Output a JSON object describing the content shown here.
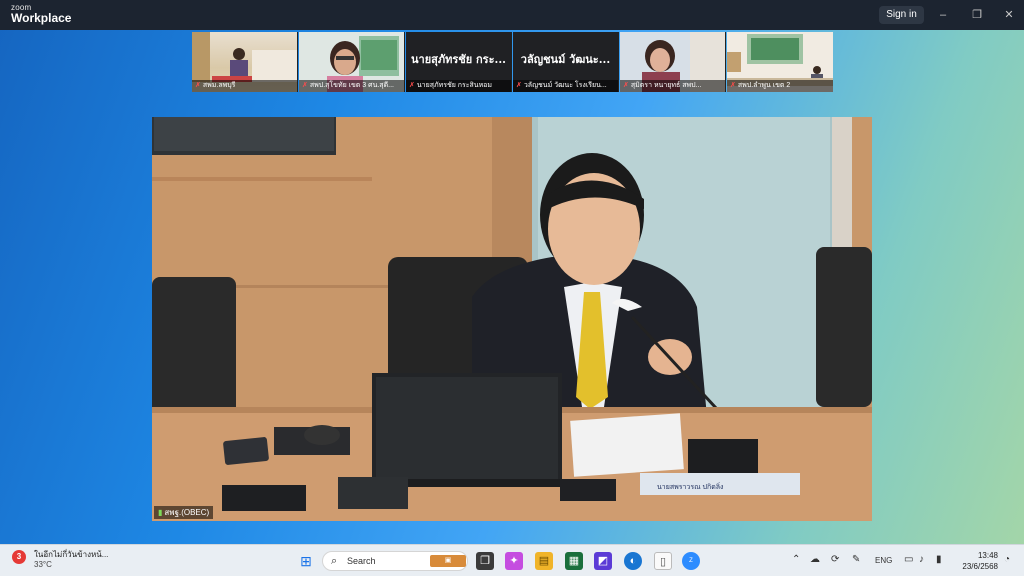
{
  "app": {
    "brand_top": "zoom",
    "brand_main": "Workplace",
    "sign_in": "Sign in"
  },
  "window_controls": [
    "–",
    "❐",
    "✕"
  ],
  "participants": [
    {
      "name": "สพม.ลพบุรี"
    },
    {
      "name": "สพป.สุโขทัย เขต 3 ศน.สุดี..."
    },
    {
      "name": "นายสุภัทรชัย กระสินหอม",
      "display": "นายสุภัทรชัย กระ..."
    },
    {
      "name": "วลัญชนม์ วัฒนะ โรงเรียน...",
      "display": "วลัญชนม์ วัฒนะ..."
    },
    {
      "name": "สุมิตรา หนายุทธ์ สพป..."
    },
    {
      "name": "สพป.ลำพูน เขต 2"
    }
  ],
  "main_video": {
    "label": "สพฐ.(OBEC)",
    "nameplate": "นายสพราวรณ ปกิดลิ่ง"
  },
  "taskbar": {
    "weather_badge": "3",
    "weather_text": "ในอีกไม่กี่วันข้างหน้...",
    "weather_temp": "33°C",
    "search_placeholder": "Search",
    "language": "ENG",
    "time": "13:48",
    "date": "23/6/2568"
  }
}
